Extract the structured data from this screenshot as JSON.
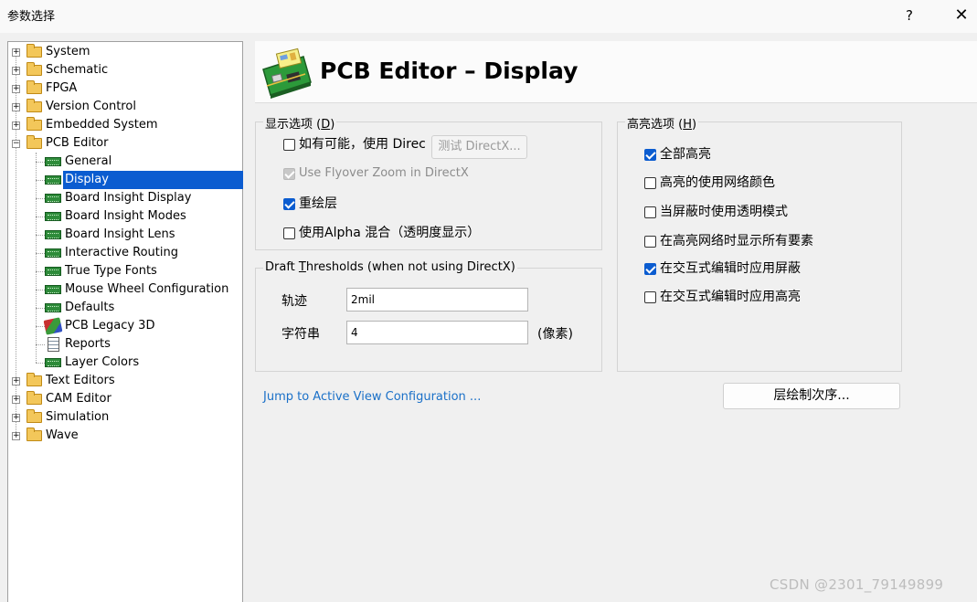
{
  "window": {
    "title": "参数选择",
    "help_label": "?",
    "close_label": "✕"
  },
  "tree": {
    "items": [
      {
        "label": "System",
        "icon": "folder-icon",
        "expander": "+"
      },
      {
        "label": "Schematic",
        "icon": "folder-icon",
        "expander": "+"
      },
      {
        "label": "FPGA",
        "icon": "folder-icon",
        "expander": "+"
      },
      {
        "label": "Version Control",
        "icon": "folder-icon",
        "expander": "+"
      },
      {
        "label": "Embedded System",
        "icon": "folder-icon",
        "expander": "+"
      },
      {
        "label": "PCB Editor",
        "icon": "folder-open-icon",
        "expander": "−"
      },
      {
        "label": "General",
        "icon": "pcb-board-icon"
      },
      {
        "label": "Display",
        "icon": "pcb-board-icon",
        "selected": true
      },
      {
        "label": "Board Insight Display",
        "icon": "pcb-board-icon"
      },
      {
        "label": "Board Insight Modes",
        "icon": "pcb-board-icon"
      },
      {
        "label": "Board Insight Lens",
        "icon": "pcb-board-icon"
      },
      {
        "label": "Interactive Routing",
        "icon": "pcb-board-icon"
      },
      {
        "label": "True Type Fonts",
        "icon": "pcb-board-icon"
      },
      {
        "label": "Mouse Wheel Configuration",
        "icon": "pcb-board-icon"
      },
      {
        "label": "Defaults",
        "icon": "pcb-board-icon"
      },
      {
        "label": "PCB Legacy 3D",
        "icon": "legacy-3d-icon"
      },
      {
        "label": "Reports",
        "icon": "report-icon"
      },
      {
        "label": "Layer Colors",
        "icon": "pcb-board-icon"
      },
      {
        "label": "Text Editors",
        "icon": "folder-icon",
        "expander": "+"
      },
      {
        "label": "CAM Editor",
        "icon": "folder-icon",
        "expander": "+"
      },
      {
        "label": "Simulation",
        "icon": "folder-icon",
        "expander": "+"
      },
      {
        "label": "Wave",
        "icon": "folder-icon",
        "expander": "+"
      }
    ]
  },
  "header": {
    "title": "PCB Editor – Display"
  },
  "display_options": {
    "title_prefix": "显示选项 (",
    "title_key": "D",
    "title_suffix": ")",
    "use_directx_label": "如有可能，使用 Direc",
    "use_directx_checked": false,
    "test_directx_button": "测试 DirectX...",
    "flyover_label": "Use Flyover Zoom in DirectX",
    "flyover_checked": true,
    "redraw_layers_label": "重绘层",
    "redraw_layers_checked": true,
    "alpha_blend_label": "使用Alpha 混合（透明度显示）",
    "alpha_blend_checked": false
  },
  "draft_thresholds": {
    "title_prefix": "Draft ",
    "title_key": "T",
    "title_suffix": "hresholds (when not using DirectX)",
    "tracks_label": "轨迹",
    "tracks_value": "2mil",
    "strings_label": "字符串",
    "strings_value": "4",
    "strings_unit": "(像素)"
  },
  "highlight_options": {
    "title_prefix": "高亮选项 (",
    "title_key": "H",
    "title_suffix": ")",
    "items": [
      {
        "label": "全部高亮",
        "checked": true
      },
      {
        "label": "高亮的使用网络颜色",
        "checked": false
      },
      {
        "label": "当屏蔽时使用透明模式",
        "checked": false
      },
      {
        "label": "在高亮网络时显示所有要素",
        "checked": false
      },
      {
        "label": "在交互式编辑时应用屏蔽",
        "checked": true
      },
      {
        "label": "在交互式编辑时应用高亮",
        "checked": false
      }
    ]
  },
  "footer": {
    "jump_link": "Jump to Active View Configuration ...",
    "layer_order_button": "层绘制次序..."
  },
  "watermark": "CSDN @2301_79149899",
  "colors": {
    "accent": "#0b5cd0",
    "link": "#1a70c8",
    "background": "#f0f0f0"
  }
}
